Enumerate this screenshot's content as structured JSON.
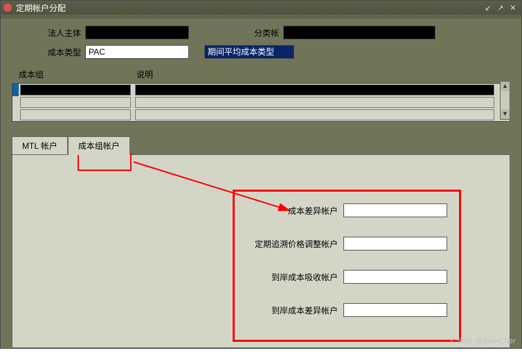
{
  "titlebar": {
    "title": "定期帐户分配",
    "min": "↙",
    "max": "↗",
    "close": "✕"
  },
  "form": {
    "legal_entity_label": "法人主体",
    "legal_entity_value": "",
    "ledger_label": "分类帐",
    "ledger_value": "",
    "cost_type_label": "成本类型",
    "cost_type_value": "PAC",
    "period_cost_type_value": "期间平均成本类型"
  },
  "grid": {
    "col_cost_group": "成本组",
    "col_description": "说明",
    "rows": [
      {
        "cost_group": "",
        "description": ""
      },
      {
        "cost_group": "",
        "description": ""
      },
      {
        "cost_group": "",
        "description": ""
      }
    ]
  },
  "tabs": {
    "mtl": "MTL 帐户",
    "cost_group": "成本组帐户"
  },
  "accounts": {
    "variance_label": "成本差异帐户",
    "variance_value": "",
    "retro_label": "定期追溯价格调整帐户",
    "retro_value": "",
    "landed_absorb_label": "到岸成本吸收帐户",
    "landed_absorb_value": "",
    "landed_var_label": "到岸成本差异帐户",
    "landed_var_value": ""
  },
  "scroll": {
    "up": "▲",
    "down": "▼"
  },
  "watermark": "CSDN @AlanCher"
}
